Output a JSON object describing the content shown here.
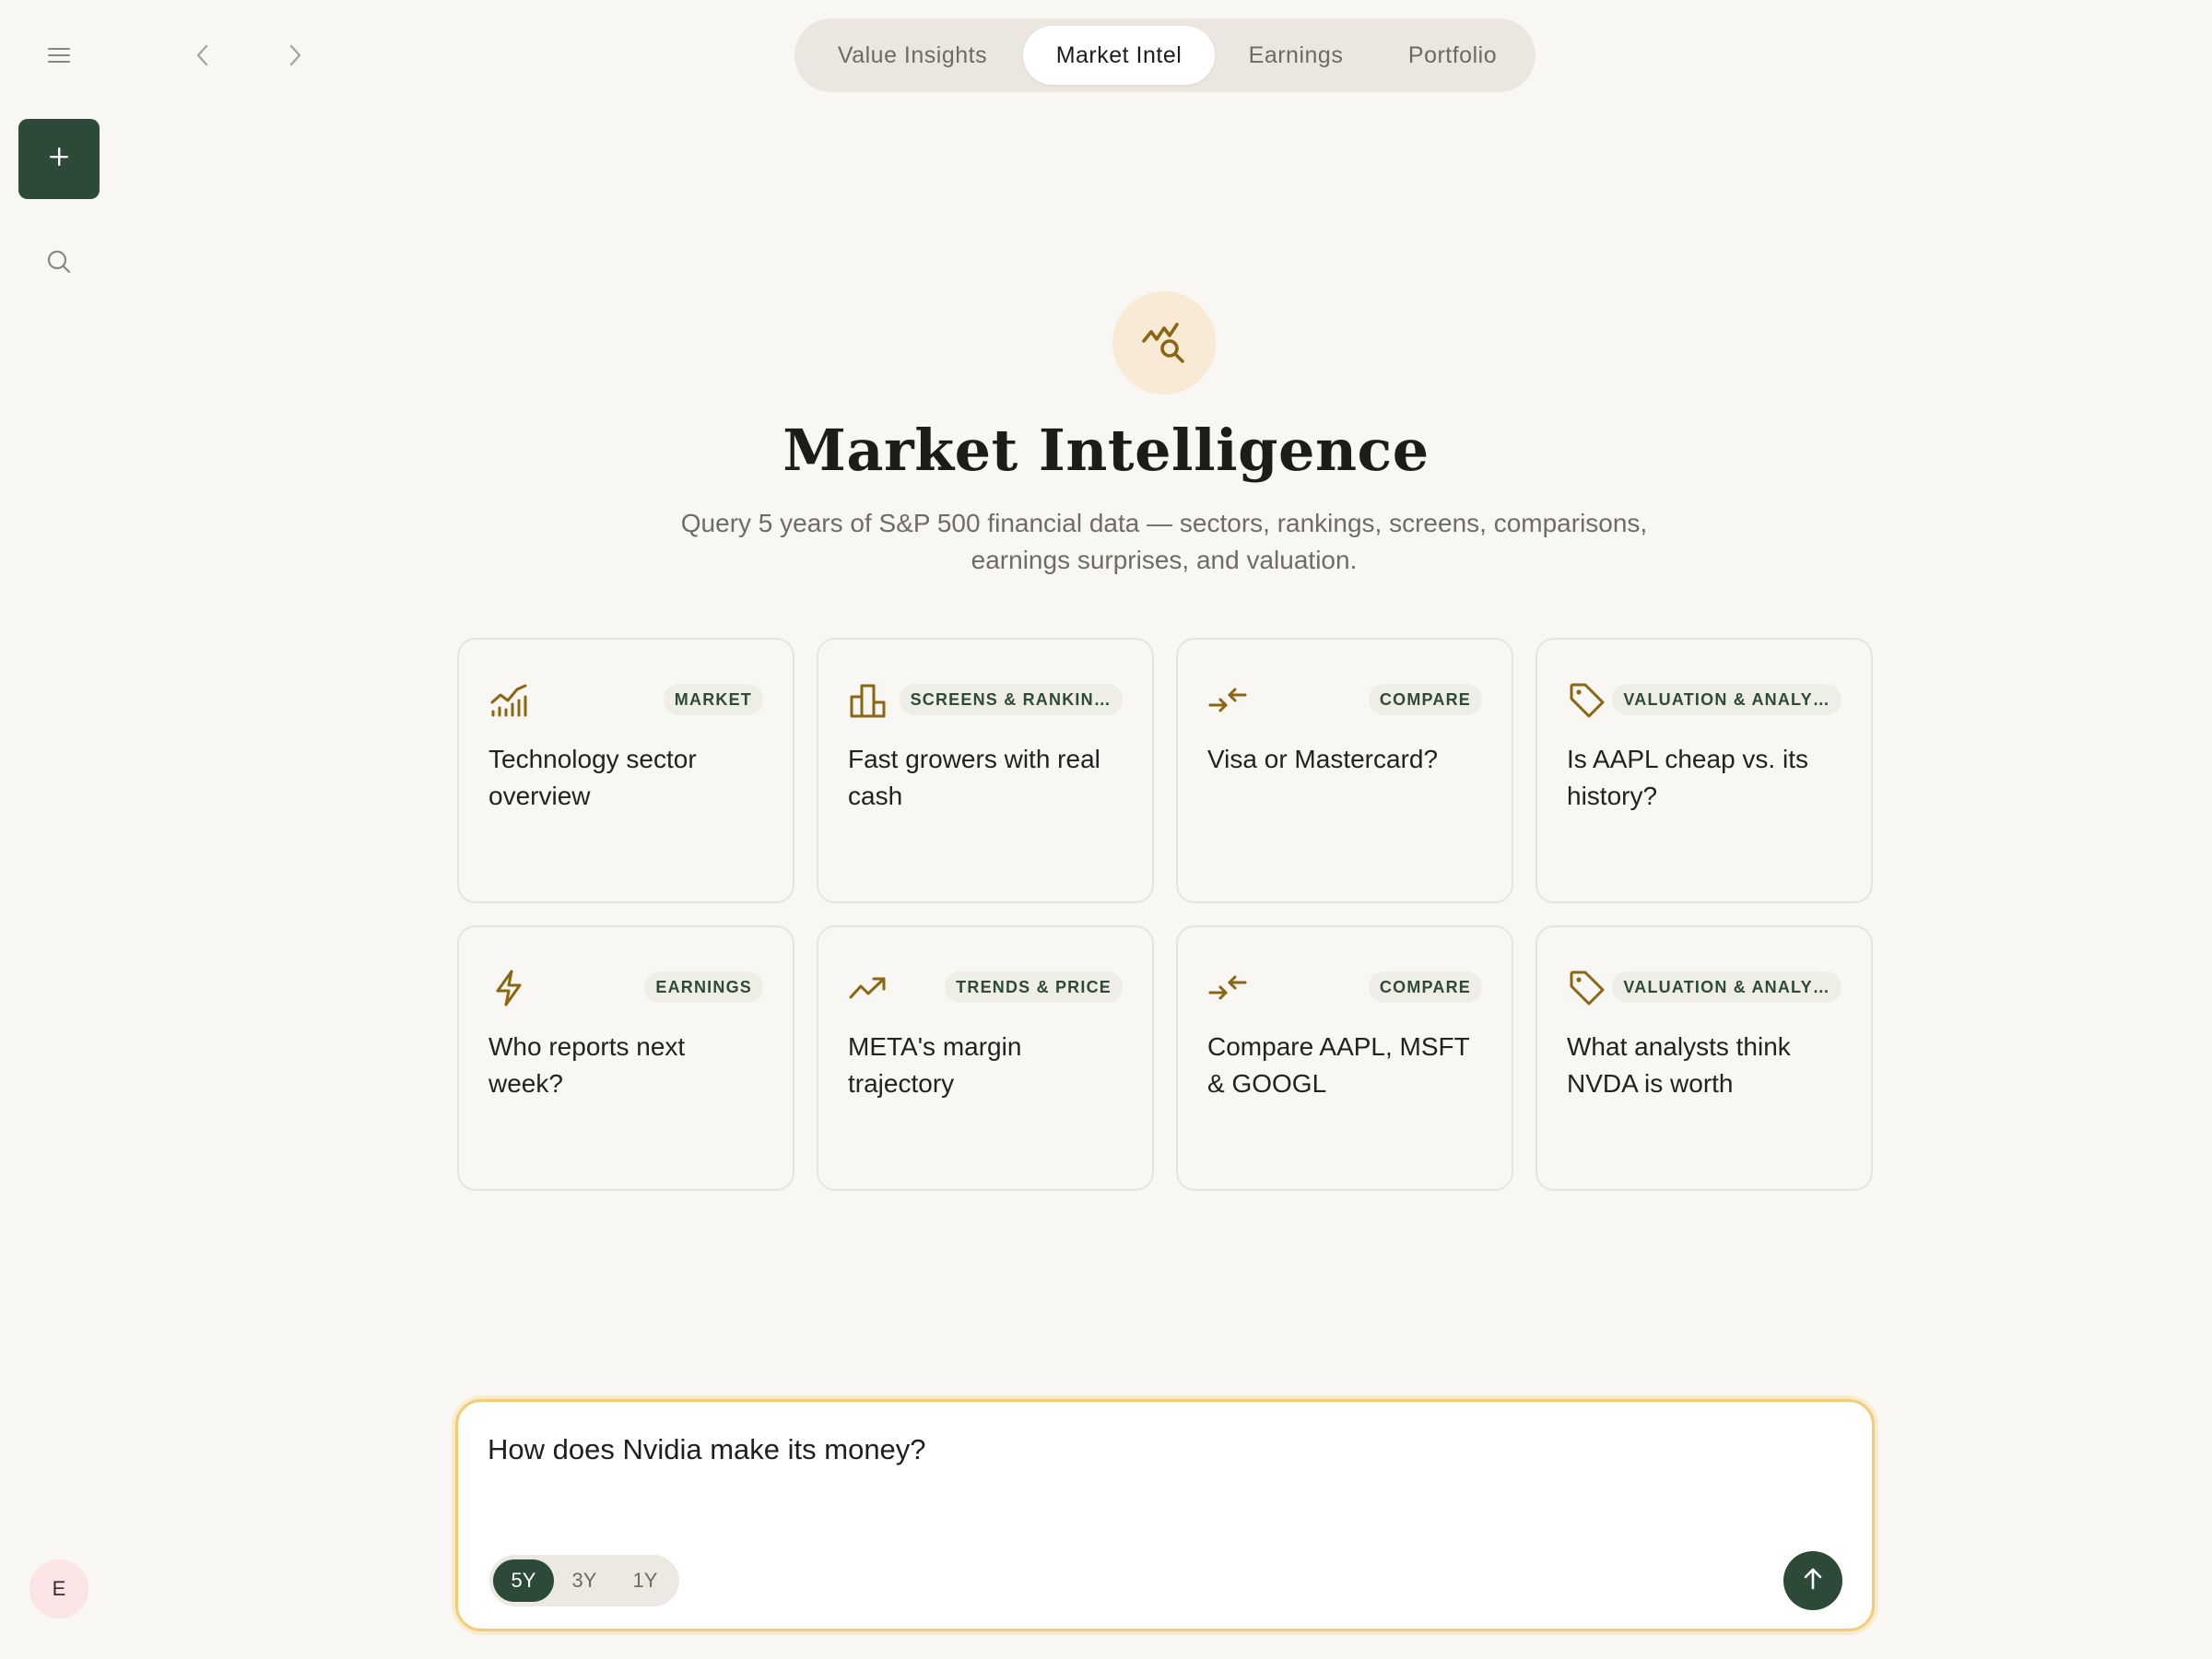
{
  "colors": {
    "accent_green": "#2c4a37",
    "icon_gold": "#8a6512",
    "input_border": "#f4cb74",
    "background": "#f9f7f3"
  },
  "sidebar": {
    "menu_icon": "hamburger-icon",
    "new_icon": "plus-icon",
    "search_icon": "search-icon",
    "avatar_initial": "E"
  },
  "nav": {
    "back_icon": "chevron-left-icon",
    "forward_icon": "chevron-right-icon"
  },
  "tabs": [
    {
      "label": "Value Insights",
      "active": false
    },
    {
      "label": "Market Intel",
      "active": true
    },
    {
      "label": "Earnings",
      "active": false
    },
    {
      "label": "Portfolio",
      "active": false
    }
  ],
  "hero": {
    "icon": "chart-search-icon",
    "title": "Market Intelligence",
    "subtitle": "Query 5 years of S&P 500 financial data — sectors, rankings, screens, comparisons, earnings surprises, and valuation."
  },
  "cards": [
    {
      "icon": "bar-chart-trend-icon",
      "badge": "MARKET",
      "text": "Technology sector overview"
    },
    {
      "icon": "buildings-bar-icon",
      "badge": "SCREENS & RANKIN…",
      "text": "Fast growers with real cash"
    },
    {
      "icon": "compare-arrows-icon",
      "badge": "COMPARE",
      "text": "Visa or Mastercard?"
    },
    {
      "icon": "price-tag-icon",
      "badge": "VALUATION & ANALY…",
      "text": "Is AAPL cheap vs. its history?"
    },
    {
      "icon": "lightning-icon",
      "badge": "EARNINGS",
      "text": "Who reports next week?"
    },
    {
      "icon": "trending-up-icon",
      "badge": "TRENDS & PRICE",
      "text": "META's margin trajectory"
    },
    {
      "icon": "compare-arrows-icon",
      "badge": "COMPARE",
      "text": "Compare AAPL, MSFT & GOOGL"
    },
    {
      "icon": "price-tag-icon",
      "badge": "VALUATION & ANALY…",
      "text": "What analysts think NVDA is worth"
    }
  ],
  "composer": {
    "value": "How does Nvidia make its money?",
    "ranges": [
      {
        "label": "5Y",
        "active": true
      },
      {
        "label": "3Y",
        "active": false
      },
      {
        "label": "1Y",
        "active": false
      }
    ],
    "send_icon": "arrow-up-icon"
  }
}
